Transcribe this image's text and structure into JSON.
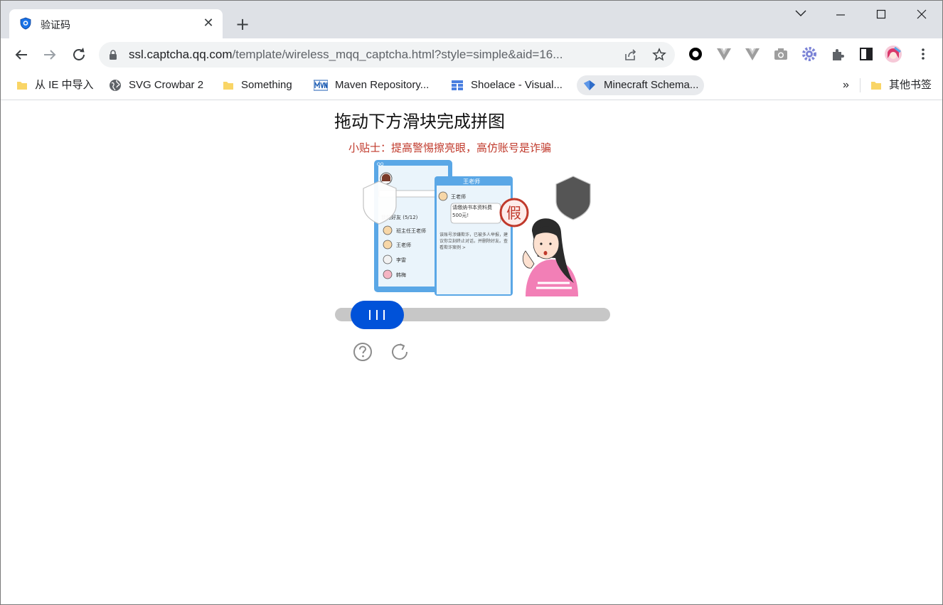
{
  "tab": {
    "title": "验证码"
  },
  "address_bar": {
    "host": "ssl.captcha.qq.com",
    "path": "/template/wireless_mqq_captcha.html?style=simple&aid=16..."
  },
  "bookmarks": [
    {
      "label": "从 IE 中导入",
      "icon": "folder-icon"
    },
    {
      "label": "SVG Crowbar 2",
      "icon": "globe-icon"
    },
    {
      "label": "Something",
      "icon": "folder-icon"
    },
    {
      "label": "Maven Repository...",
      "icon": "mvn-icon"
    },
    {
      "label": "Shoelace - Visual...",
      "icon": "grid-icon"
    },
    {
      "label": "Minecraft Schema...",
      "icon": "diamond-icon"
    }
  ],
  "bookmarks_overflow": "»",
  "other_bookmarks": {
    "label": "其他书签"
  },
  "captcha": {
    "instruction": "拖动下方滑块完成拼图",
    "tip": "小贴士：提高警惕擦亮眼，高仿账号是诈骗",
    "chat_window_title": "王老师",
    "chat_message": "请缴纳书本资料费500元!",
    "chat_warning": "该账号涉嫌欺诈，已被多人举报，建议你立刻终止对话，并删除好友。查看欺诈案例 >",
    "fake_stamp": "假",
    "contacts_header": "我的好友 (5/12)",
    "contacts": [
      "班主任王老师",
      "王老师",
      "李雷",
      "韩梅"
    ],
    "slider_progress": 0.07,
    "accent_color": "#0052d9"
  }
}
